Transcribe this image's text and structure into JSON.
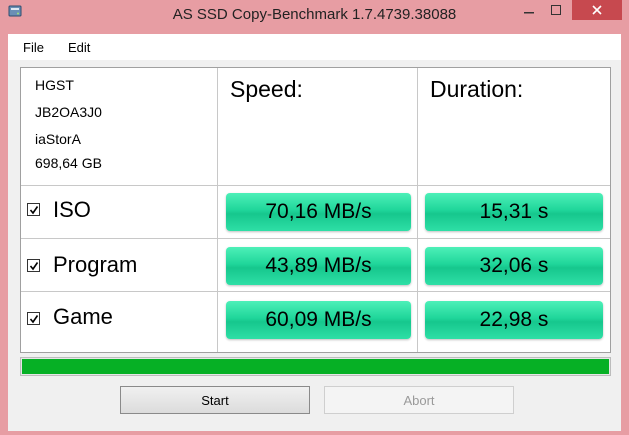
{
  "window": {
    "title": "AS SSD Copy-Benchmark 1.7.4739.38088",
    "icon": "disk-app-icon",
    "controls": {
      "minimize": "minimize-icon",
      "maximize": "maximize-icon",
      "close": "close-icon"
    }
  },
  "menu": {
    "file": "File",
    "edit": "Edit"
  },
  "drive": {
    "model": "HGST",
    "firmware": "JB2OA3J0",
    "driver": "iaStorA",
    "capacity": "698,64 GB"
  },
  "columns": {
    "speed": "Speed:",
    "duration": "Duration:"
  },
  "rows": [
    {
      "label": "ISO",
      "checked": true,
      "speed": "70,16 MB/s",
      "duration": "15,31 s"
    },
    {
      "label": "Program",
      "checked": true,
      "speed": "43,89 MB/s",
      "duration": "32,06 s"
    },
    {
      "label": "Game",
      "checked": true,
      "speed": "60,09 MB/s",
      "duration": "22,98 s"
    }
  ],
  "progress": {
    "fraction": 1.0,
    "color": "#06b025"
  },
  "buttons": {
    "start": "Start",
    "abort": "Abort"
  },
  "colors": {
    "result_green": "#1fd69a",
    "titlebar": "#e79da3",
    "close_button": "#c7494f"
  }
}
